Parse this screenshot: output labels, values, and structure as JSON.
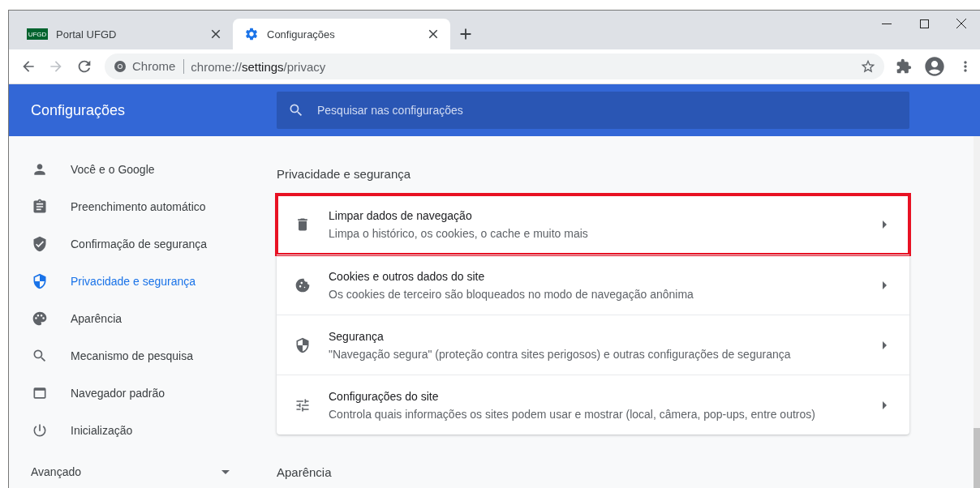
{
  "tabs": [
    {
      "title": "Portal UFGD",
      "favicon_text": "UFGD",
      "selected": false
    },
    {
      "title": "Configurações",
      "selected": true
    }
  ],
  "address_bar": {
    "chip": "Chrome",
    "url_prefix": "chrome://",
    "url_host": "settings",
    "url_path": "/privacy"
  },
  "header": {
    "title": "Configurações",
    "search_placeholder": "Pesquisar nas configurações"
  },
  "sidebar": {
    "items": [
      {
        "label": "Você e o Google",
        "selected": false
      },
      {
        "label": "Preenchimento automático",
        "selected": false
      },
      {
        "label": "Confirmação de segurança",
        "selected": false
      },
      {
        "label": "Privacidade e segurança",
        "selected": true
      },
      {
        "label": "Aparência",
        "selected": false
      },
      {
        "label": "Mecanismo de pesquisa",
        "selected": false
      },
      {
        "label": "Navegador padrão",
        "selected": false
      },
      {
        "label": "Inicialização",
        "selected": false
      }
    ],
    "advanced": {
      "label": "Avançado",
      "expanded": false
    }
  },
  "section": {
    "title": "Privacidade e segurança",
    "rows": [
      {
        "title": "Limpar dados de navegação",
        "subtitle": "Limpa o histórico, os cookies, o cache e muito mais",
        "highlighted": true
      },
      {
        "title": "Cookies e outros dados do site",
        "subtitle": "Os cookies de terceiro são bloqueados no modo de navegação anônima",
        "highlighted": false
      },
      {
        "title": "Segurança",
        "subtitle": "\"Navegação segura\" (proteção contra sites perigosos) e outras configurações de segurança",
        "highlighted": false
      },
      {
        "title": "Configurações do site",
        "subtitle": "Controla quais informações os sites podem usar e mostrar (local, câmera, pop-ups, entre outros)",
        "highlighted": false
      }
    ]
  },
  "next_section": {
    "title": "Aparência"
  }
}
